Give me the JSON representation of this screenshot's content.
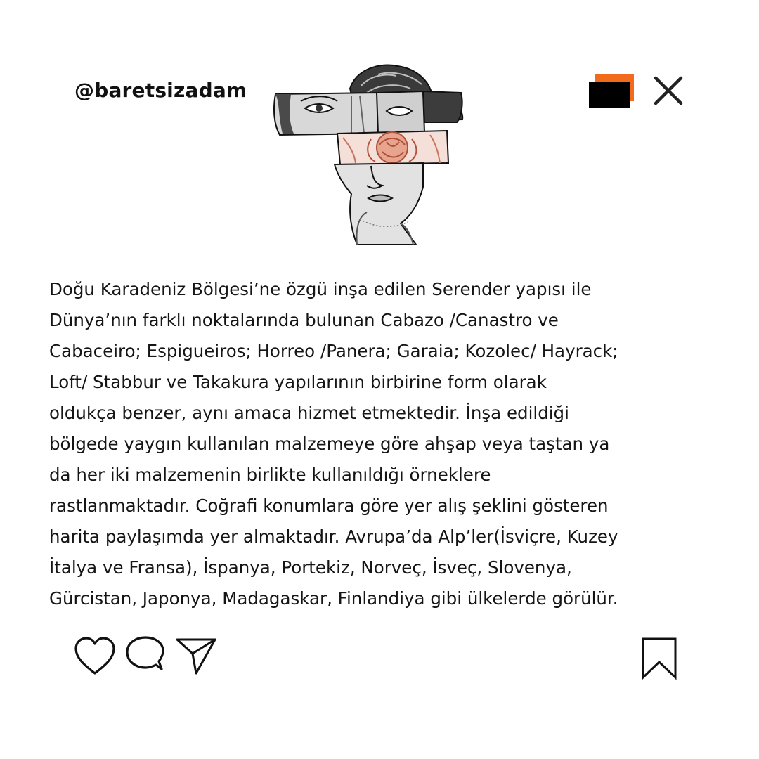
{
  "header": {
    "handle": "@baretsizadam"
  },
  "post": {
    "lines": [
      "Doğu Karadeniz Bölgesi’ne özgü inşa edilen Serender yapısı ile",
      "Dünya’nın farklı noktalarında bulunan Cabazo /Canastro ve",
      "Cabaceiro; Espigueiros; Horreo /Panera; Garaia; Kozolec/ Hayrack;",
      "Loft/ Stabbur ve Takakura yapılarının birbirine form olarak",
      "oldukça benzer, aynı amaca hizmet etmektedir. İnşa edildiği",
      "bölgede yaygın kullanılan malzemeye göre ahşap veya taştan ya",
      "da her iki malzemenin birlikte kullanıldığı örneklere",
      "rastlanmaktadır. Coğrafi konumlara göre yer alış şeklini gösteren",
      "harita paylaşımda yer almaktadır. Avrupa’da Alp’ler(İsviçre, Kuzey",
      "İtalya ve Fransa), İspanya, Portekiz, Norveç, İsveç, Slovenya,",
      "Gürcistan, Japonya, Madagaskar, Finlandiya gibi ülkelerde görülür."
    ]
  },
  "icons": {
    "header_image": "statue-head-rose-illustration",
    "window": "window-icon",
    "close": "close-icon",
    "like": "heart-icon",
    "comment": "comment-icon",
    "share": "send-icon",
    "save": "bookmark-icon"
  },
  "colors": {
    "accent": "#f26a1b",
    "rose": "#d9826a",
    "text": "#151515",
    "background": "#ffffff"
  }
}
